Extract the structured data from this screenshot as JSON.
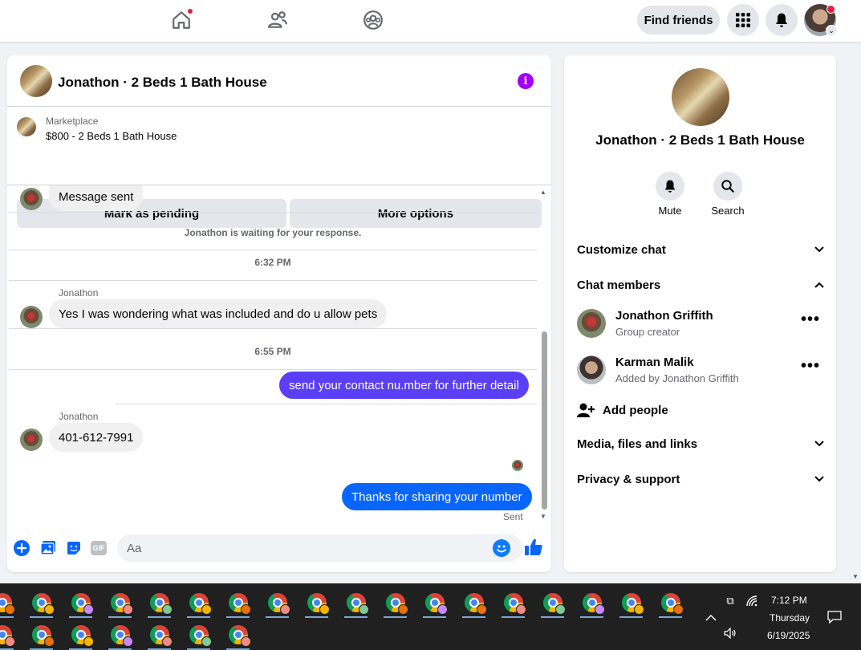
{
  "topbar": {
    "find_friends_label": "Find friends"
  },
  "chat": {
    "title": "Jonathon · 2 Beds 1 Bath House",
    "marketplace_label": "Marketplace",
    "listing_price_title": "$800 - 2 Beds 1 Bath House",
    "mark_pending_label": "Mark as pending",
    "more_options_label": "More options",
    "messages": {
      "m1": "Message sent",
      "waiting_notice": "Jonathon is waiting for your response.",
      "time1": "6:32 PM",
      "sender1": "Jonathon",
      "m2": "Yes I was wondering what was included and do u allow pets",
      "time2": "6:55 PM",
      "m3": "send your contact nu.mber for further detail",
      "sender2": "Jonathon",
      "m4": "401-612-7991",
      "m5": "Thanks for sharing your number",
      "sent_status": "Sent"
    },
    "composer_placeholder": "Aa",
    "gif_label": "GIF",
    "outgoing_color_1": "#5b3ff6",
    "outgoing_color_2": "#0866ff"
  },
  "details": {
    "title": "Jonathon · 2 Beds 1 Bath House",
    "mute_label": "Mute",
    "search_label": "Search",
    "customize_chat": "Customize chat",
    "chat_members": "Chat members",
    "members": [
      {
        "name": "Jonathon Griffith",
        "role": "Group creator"
      },
      {
        "name": "Karman Malik",
        "role": "Added by Jonathon Griffith"
      }
    ],
    "add_people": "Add people",
    "media_files_links": "Media, files and links",
    "privacy_support": "Privacy & support"
  },
  "taskbar": {
    "time": "7:12 PM",
    "day": "Thursday",
    "date": "6/19/2025"
  }
}
